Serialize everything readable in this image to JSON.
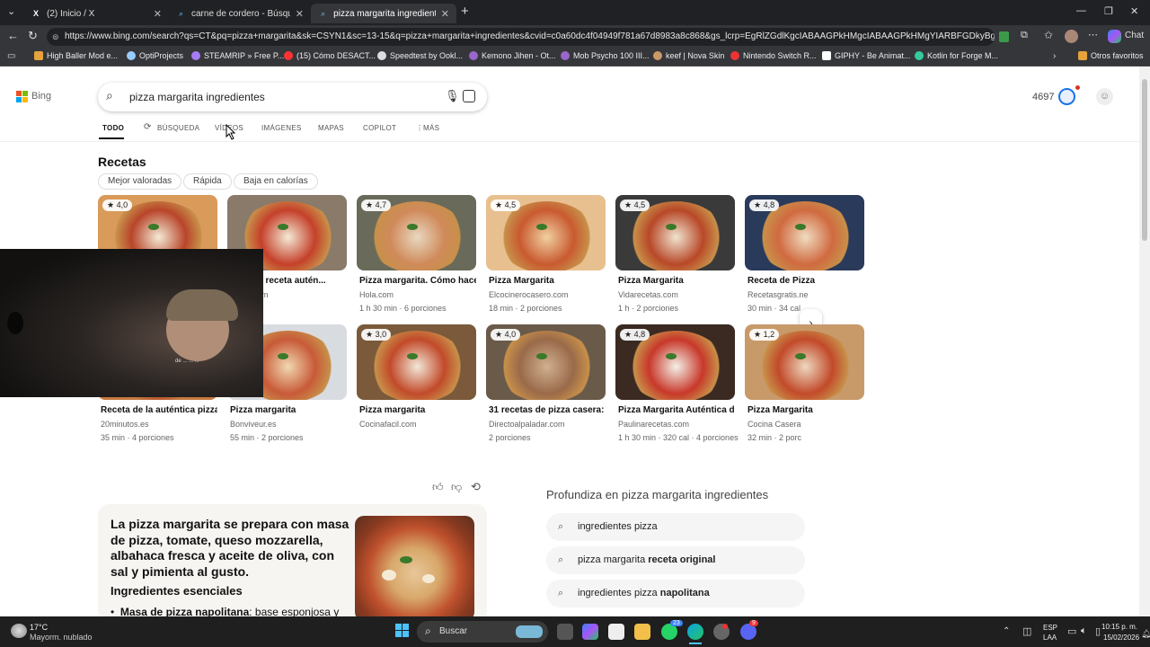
{
  "browser": {
    "tabs": [
      {
        "label": "(2) Inicio / X",
        "icon": "x-icon"
      },
      {
        "label": "carne de cordero - Búsqueda Imá",
        "icon": "search-icon"
      },
      {
        "label": "pizza margarita ingredientes - Bús",
        "icon": "search-icon",
        "active": true
      }
    ],
    "url": "https://www.bing.com/search?qs=CT&pq=pizza+margarita&sk=CSYN1&sc=13-15&q=pizza+margarita+ingredientes&cvid=c0a60dc4f04949f781a67d8983a8c868&gs_lcrp=EgRlZGdlKgcIABAAGPkHMgcIABAAGPkHMgYIARBFGDkyBggCEAAYQ...",
    "chat_label": "Chat",
    "bookmarks": [
      "High Baller Mod e...",
      "OptiProjects",
      "STEAMRIP » Free P...",
      "(15) Cómo DESACT...",
      "Speedtest by Ookl...",
      "Kemono Jihen - Ot...",
      "Mob Psycho 100 III...",
      "keef | Nova Skin",
      "Nintendo Switch R...",
      "GIPHY - Be Animat...",
      "Kotlin for Forge M..."
    ],
    "other_favorites": "Otros favoritos"
  },
  "bing": {
    "logo": "Bing",
    "query": "pizza margarita ingredientes",
    "points": "4697",
    "nav": [
      "TODO",
      "BÚSQUEDA",
      "VÍDEOS",
      "IMÁGENES",
      "MAPAS",
      "COPILOT",
      "MÁS"
    ],
    "recipes_title": "Recetas",
    "filters": [
      "Mejor valoradas",
      "Rápida",
      "Baja en calorías"
    ],
    "row1": [
      {
        "rating": "4,0",
        "title": "",
        "source": "",
        "meta": ""
      },
      {
        "rating": "",
        "title": "argarita receta autén...",
        "source": "uropa.com",
        "meta": "n"
      },
      {
        "rating": "4,7",
        "title": "Pizza margarita. Cómo hace...",
        "source": "Hola.com",
        "meta": "1 h 30 min · 6 porciones"
      },
      {
        "rating": "4,5",
        "title": "Pizza Margarita",
        "source": "Elcocinerocasero.com",
        "meta": "18 min · 2 porciones"
      },
      {
        "rating": "4,5",
        "title": "Pizza Margarita",
        "source": "Vidarecetas.com",
        "meta": "1 h · 2 porciones"
      },
      {
        "rating": "4,8",
        "title": "Receta de Pizza",
        "source": "Recetasgratis.ne",
        "meta": "30 min · 34 cal"
      }
    ],
    "row2": [
      {
        "rating": "",
        "title": "Receta de la auténtica pizza ...",
        "source": "20minutos.es",
        "meta": "35 min · 4 porciones"
      },
      {
        "rating": "",
        "title": "Pizza margarita",
        "source": "Bonviveur.es",
        "meta": "55 min · 2 porciones"
      },
      {
        "rating": "3,0",
        "title": "Pizza margarita",
        "source": "Cocinafacil.com",
        "meta": ""
      },
      {
        "rating": "4,0",
        "title": "31 recetas de pizza casera: ...",
        "source": "Directoalpaladar.com",
        "meta": "2 porciones"
      },
      {
        "rating": "4,8",
        "title": "Pizza Margarita Auténtica d...",
        "source": "Paulinarecetas.com",
        "meta": "1 h 30 min · 320 cal · 4 porciones"
      },
      {
        "rating": "1,2",
        "title": "Pizza Margarita",
        "source": "Cocina Casera",
        "meta": "32 min · 2 porc"
      }
    ],
    "answer": {
      "summary": "La pizza margarita se prepara con masa de pizza, tomate, queso mozzarella, albahaca fresca y aceite de oliva, con sal y pimienta al gusto.",
      "section": "Ingredientes esenciales",
      "bullet_bold": "Masa de pizza napolitana",
      "bullet_rest": ": base esponjosa y"
    },
    "related": {
      "title": "Profundiza en pizza margarita ingredientes",
      "items": [
        {
          "plain": "ingredientes pizza",
          "bold": ""
        },
        {
          "plain": "pizza margarita ",
          "bold": "receta original"
        },
        {
          "plain": "ingredientes pizza ",
          "bold": "napolitana"
        }
      ]
    },
    "webcam_caption": "de ... ... ..."
  },
  "taskbar": {
    "weather_temp": "17°C",
    "weather_desc": "Mayorm. nublado",
    "search": "Buscar",
    "lang1": "ESP",
    "lang2": "LAA",
    "time": "10:15 p. m.",
    "date": "15/02/2026",
    "badge1": "23",
    "badge2": "9"
  }
}
